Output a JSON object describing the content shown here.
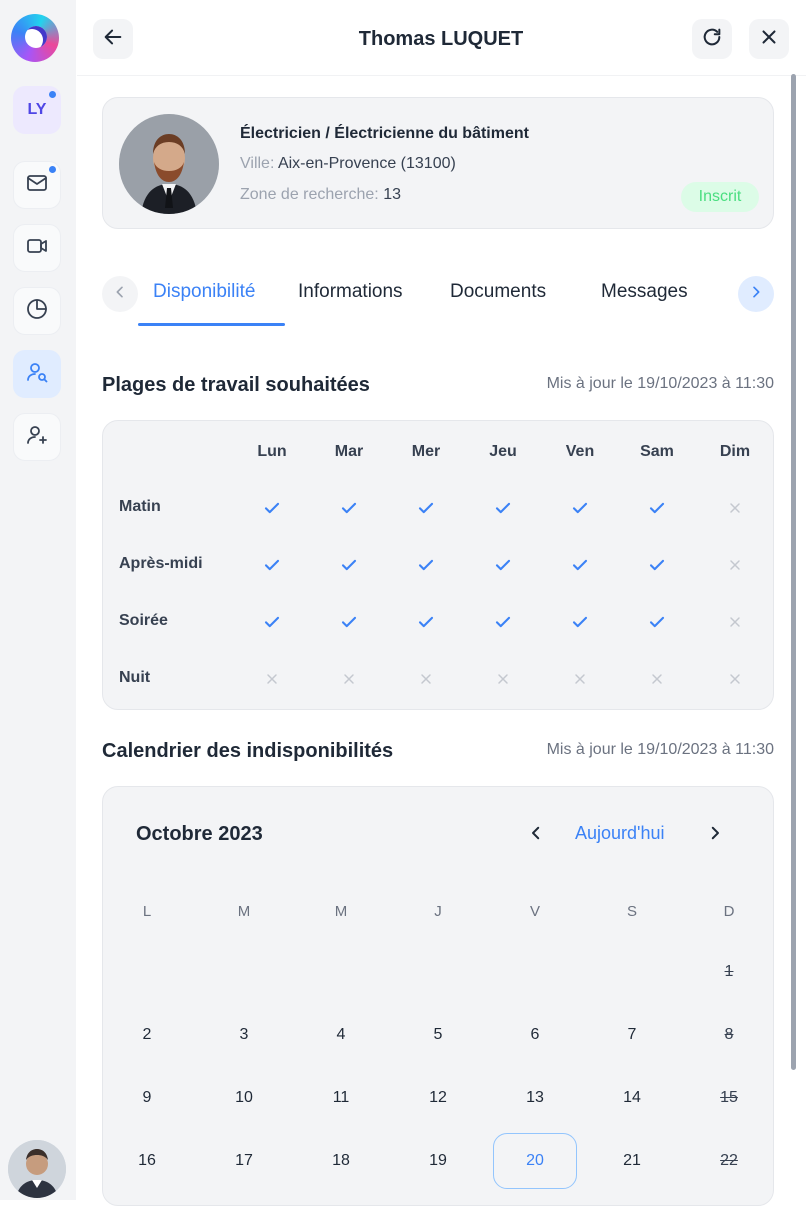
{
  "sidebar": {
    "items": [
      {
        "name": "LY",
        "icon": "initials-badge"
      },
      {
        "icon": "mail-icon"
      },
      {
        "icon": "video-icon"
      },
      {
        "icon": "chart-pie-icon"
      },
      {
        "icon": "user-search-icon"
      },
      {
        "icon": "user-add-icon"
      }
    ],
    "initials": "LY"
  },
  "header": {
    "title": "Thomas LUQUET",
    "back_icon": "arrow-left-icon",
    "refresh_icon": "refresh-icon",
    "close_icon": "close-icon"
  },
  "profile": {
    "job": "Électricien / Électricienne du bâtiment",
    "city_label": "Ville:",
    "city_value": "Aix-en-Provence (13100)",
    "zone_label": "Zone de recherche:",
    "zone_value": "13",
    "status": "Inscrit"
  },
  "tabs": {
    "items": [
      "Disponibilité",
      "Informations",
      "Documents",
      "Messages"
    ],
    "active": "Disponibilité"
  },
  "availability": {
    "title": "Plages de travail souhaitées",
    "updated": "Mis à jour le 19/10/2023 à 11:30",
    "days": [
      "Lun",
      "Mar",
      "Mer",
      "Jeu",
      "Ven",
      "Sam",
      "Dim"
    ],
    "rows": [
      {
        "label": "Matin",
        "values": [
          true,
          true,
          true,
          true,
          true,
          true,
          false
        ]
      },
      {
        "label": "Après-midi",
        "values": [
          true,
          true,
          true,
          true,
          true,
          true,
          false
        ]
      },
      {
        "label": "Soirée",
        "values": [
          true,
          true,
          true,
          true,
          true,
          true,
          false
        ]
      },
      {
        "label": "Nuit",
        "values": [
          false,
          false,
          false,
          false,
          false,
          false,
          false
        ]
      }
    ]
  },
  "calendar": {
    "title": "Calendrier des indisponibilités",
    "updated": "Mis à jour le 19/10/2023 à 11:30",
    "month": "Octobre 2023",
    "today_label": "Aujourd'hui",
    "weekdays": [
      "L",
      "M",
      "M",
      "J",
      "V",
      "S",
      "D"
    ],
    "weeks": [
      [
        "",
        "",
        "",
        "",
        "",
        "",
        "1"
      ],
      [
        "2",
        "3",
        "4",
        "5",
        "6",
        "7",
        "8"
      ],
      [
        "9",
        "10",
        "11",
        "12",
        "13",
        "14",
        "15"
      ],
      [
        "16",
        "17",
        "18",
        "19",
        "20",
        "21",
        "22"
      ]
    ],
    "today": "20",
    "colors": {
      "accent": "#3b82f6",
      "check": "#3b82f6",
      "cross": "#c4c8cf"
    }
  }
}
